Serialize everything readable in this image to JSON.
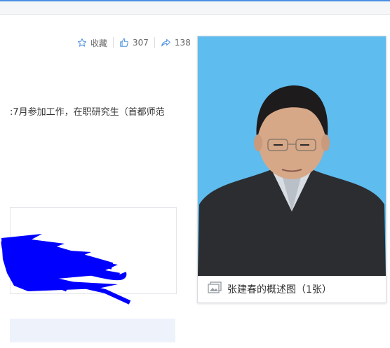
{
  "actions": {
    "favorite_label": "收藏",
    "like_count": "307",
    "share_count": "138"
  },
  "summary_snippet": ":7月参加工作，在职研究生（首都师范",
  "album": {
    "caption": "张建春的概述图（1张）"
  },
  "colors": {
    "accent": "#4a90e2",
    "photo_background": "#5ebcee",
    "redaction": "#0000ff"
  }
}
